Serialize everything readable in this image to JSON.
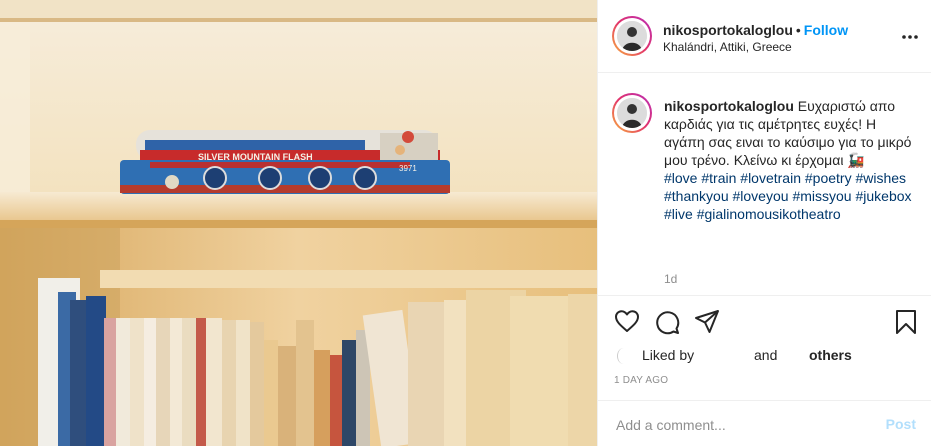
{
  "header": {
    "username": "nikosportokaloglou",
    "separator": "•",
    "follow_label": "Follow",
    "location": "Khalándri, Attiki, Greece",
    "more_icon": "more-horizontal-icon"
  },
  "photo": {
    "train_text": "SILVER MOUNTAIN FLASH",
    "train_number": "3971"
  },
  "caption": {
    "username": "nikosportokaloglou",
    "text": "Ευχαριστώ απο καρδιάς για τις αμέτρητες ευχές! Η αγάπη σας ειναι το καύσιμο για το μικρό μου τρένο. Κλείνω κι έρχομαι",
    "emoji": "🚂",
    "hashtags": [
      "#love",
      "#train",
      "#lovetrain",
      "#poetry",
      "#wishes",
      "#thankyou",
      "#loveyou",
      "#missyou",
      "#jukebox",
      "#live",
      "#gialinomousikotheatro"
    ],
    "age": "1d"
  },
  "actions": {
    "like_icon": "heart-icon",
    "comment_icon": "comment-icon",
    "share_icon": "share-icon",
    "save_icon": "bookmark-icon"
  },
  "likes": {
    "liked_by": "Liked by",
    "and": "and",
    "others": "others"
  },
  "timestamp": "1 DAY AGO",
  "comment": {
    "placeholder": "Add a comment...",
    "post_label": "Post"
  },
  "colors": {
    "link_blue": "#0095f6",
    "post_disabled": "#b2dffc",
    "hashtag": "#00376b",
    "muted": "#8e8e8e"
  }
}
